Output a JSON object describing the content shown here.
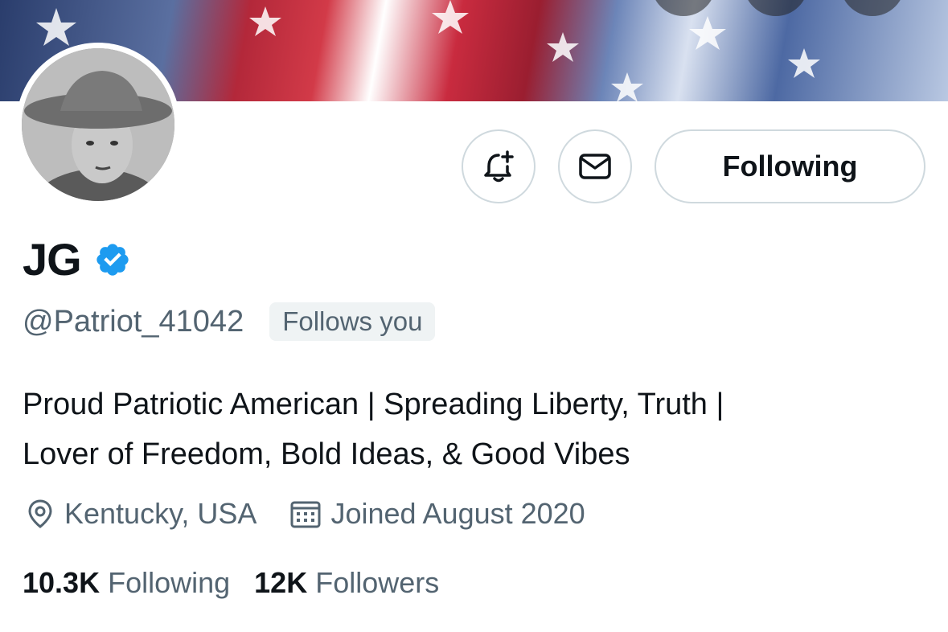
{
  "profile": {
    "display_name": "JG",
    "handle": "@Patriot_41042",
    "follows_you_badge": "Follows you",
    "bio_line1": "Proud Patriotic American | Spreading Liberty, Truth |",
    "bio_line2": "Lover of Freedom, Bold Ideas, & Good Vibes",
    "location": "Kentucky, USA",
    "joined": "Joined August 2020",
    "verified": true
  },
  "actions": {
    "following_label": "Following",
    "notify_icon": "bell-plus-icon",
    "message_icon": "envelope-icon"
  },
  "stats": {
    "following_count": "10.3K",
    "following_label": "Following",
    "followers_count": "12K",
    "followers_label": "Followers"
  },
  "colors": {
    "accent_verified": "#1d9bf0",
    "secondary_text": "#536471",
    "border": "#cfd9de"
  }
}
